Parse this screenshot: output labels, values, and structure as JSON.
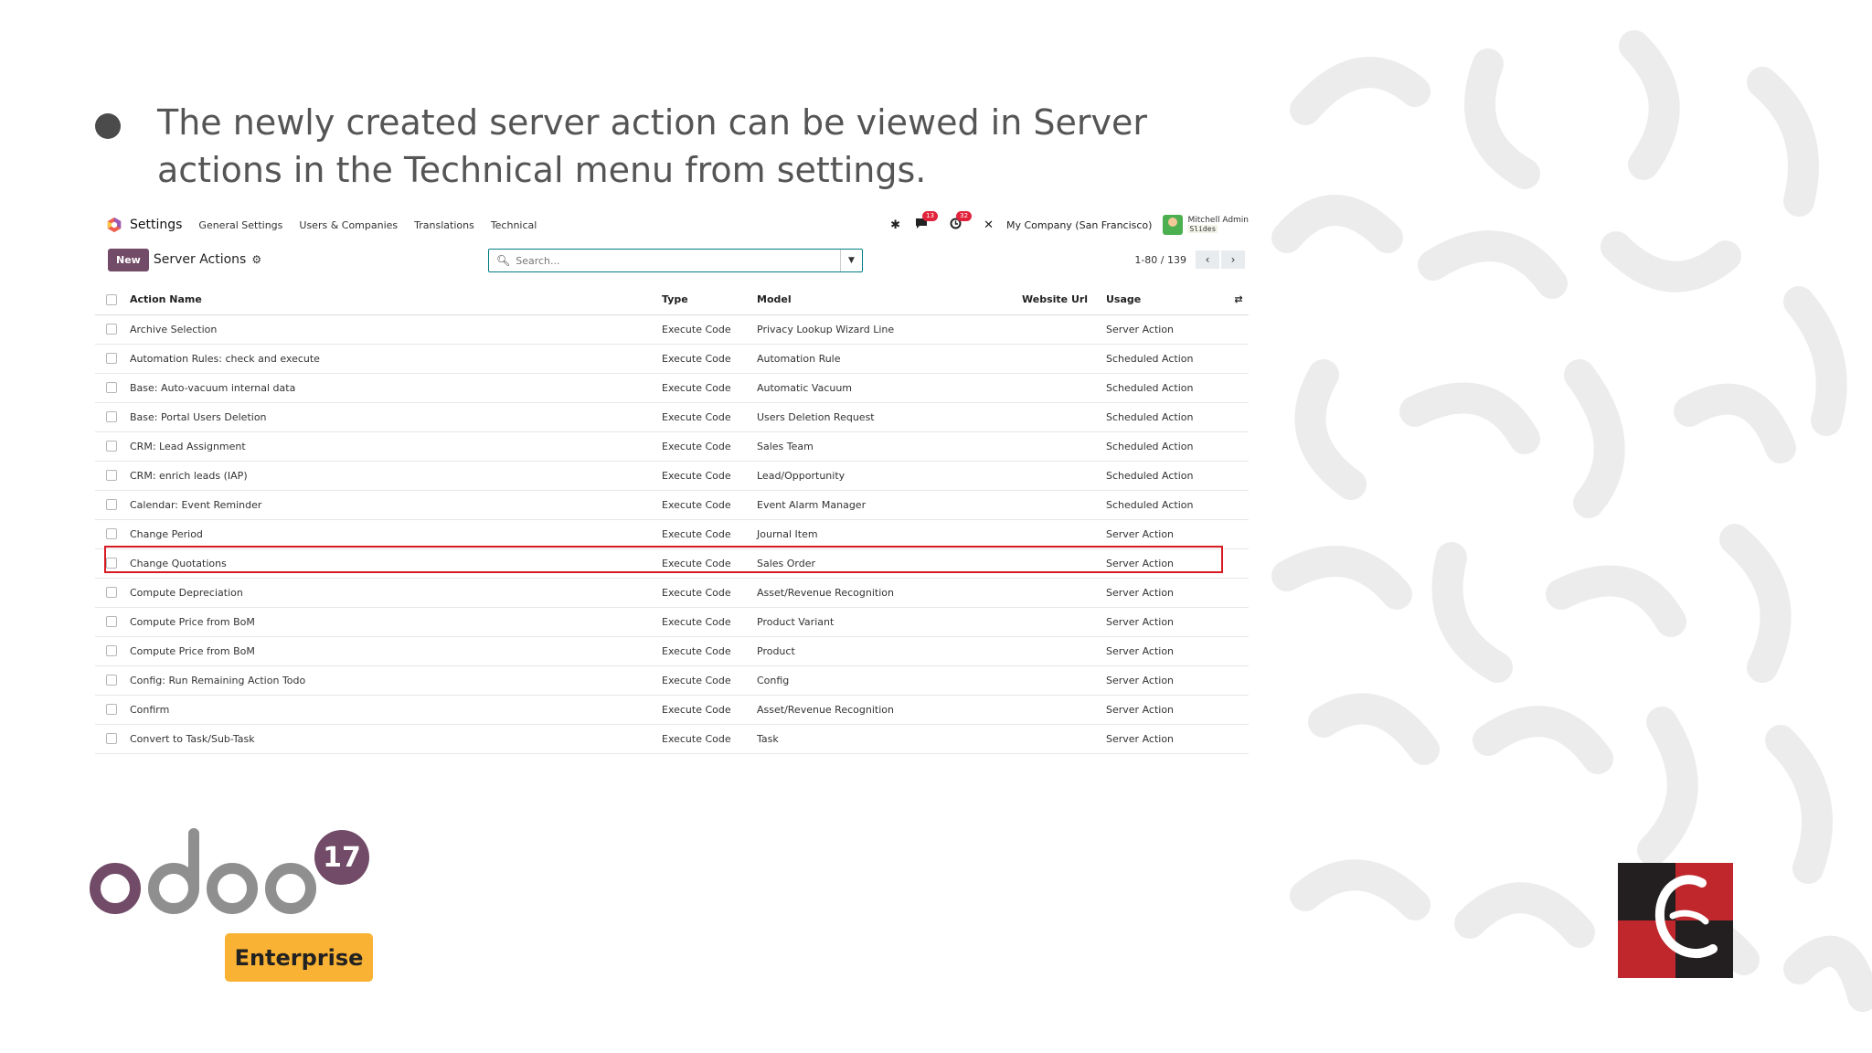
{
  "slide": {
    "bullet_text": "The newly created server action can be viewed in Server actions in the Technical menu from settings.",
    "enterprise_label": "Enterprise",
    "odoo_version": "17"
  },
  "navbar": {
    "app_name": "Settings",
    "menu": [
      "General Settings",
      "Users & Companies",
      "Translations",
      "Technical"
    ],
    "messages_badge": "13",
    "activities_badge": "32",
    "company": "My Company (San Francisco)",
    "user_name": "Mitchell Admin",
    "db_name": "Slides"
  },
  "control": {
    "new_label": "New",
    "breadcrumb": "Server Actions",
    "search_placeholder": "Search...",
    "pager": "1-80 / 139"
  },
  "table": {
    "headers": {
      "name": "Action Name",
      "type": "Type",
      "model": "Model",
      "url": "Website Url",
      "usage": "Usage"
    },
    "rows": [
      {
        "name": "Archive Selection",
        "type": "Execute Code",
        "model": "Privacy Lookup Wizard Line",
        "url": "",
        "usage": "Server Action"
      },
      {
        "name": "Automation Rules: check and execute",
        "type": "Execute Code",
        "model": "Automation Rule",
        "url": "",
        "usage": "Scheduled Action"
      },
      {
        "name": "Base: Auto-vacuum internal data",
        "type": "Execute Code",
        "model": "Automatic Vacuum",
        "url": "",
        "usage": "Scheduled Action"
      },
      {
        "name": "Base: Portal Users Deletion",
        "type": "Execute Code",
        "model": "Users Deletion Request",
        "url": "",
        "usage": "Scheduled Action"
      },
      {
        "name": "CRM: Lead Assignment",
        "type": "Execute Code",
        "model": "Sales Team",
        "url": "",
        "usage": "Scheduled Action"
      },
      {
        "name": "CRM: enrich leads (IAP)",
        "type": "Execute Code",
        "model": "Lead/Opportunity",
        "url": "",
        "usage": "Scheduled Action"
      },
      {
        "name": "Calendar: Event Reminder",
        "type": "Execute Code",
        "model": "Event Alarm Manager",
        "url": "",
        "usage": "Scheduled Action"
      },
      {
        "name": "Change Period",
        "type": "Execute Code",
        "model": "Journal Item",
        "url": "",
        "usage": "Server Action"
      },
      {
        "name": "Change Quotations",
        "type": "Execute Code",
        "model": "Sales Order",
        "url": "",
        "usage": "Server Action"
      },
      {
        "name": "Compute Depreciation",
        "type": "Execute Code",
        "model": "Asset/Revenue Recognition",
        "url": "",
        "usage": "Server Action"
      },
      {
        "name": "Compute Price from BoM",
        "type": "Execute Code",
        "model": "Product Variant",
        "url": "",
        "usage": "Server Action"
      },
      {
        "name": "Compute Price from BoM",
        "type": "Execute Code",
        "model": "Product",
        "url": "",
        "usage": "Server Action"
      },
      {
        "name": "Config: Run Remaining Action Todo",
        "type": "Execute Code",
        "model": "Config",
        "url": "",
        "usage": "Server Action"
      },
      {
        "name": "Confirm",
        "type": "Execute Code",
        "model": "Asset/Revenue Recognition",
        "url": "",
        "usage": "Server Action"
      },
      {
        "name": "Convert to Task/Sub-Task",
        "type": "Execute Code",
        "model": "Task",
        "url": "",
        "usage": "Server Action"
      }
    ]
  },
  "colors": {
    "primary": "#714b67",
    "search_border": "#017e84",
    "highlight": "#d81b22",
    "enterprise_badge": "#f9b233",
    "cyb_red": "#c0272d",
    "cyb_dark": "#231f20"
  }
}
